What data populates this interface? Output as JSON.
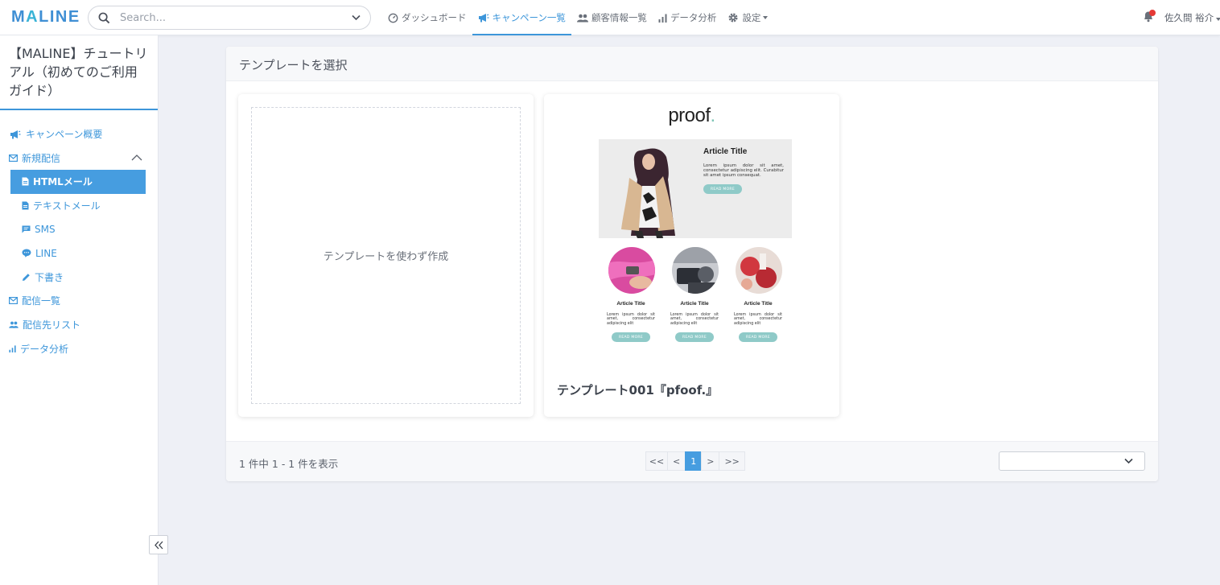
{
  "app": {
    "logo": "MALINE",
    "search_placeholder": "Search...",
    "nav": [
      {
        "label": "ダッシュボード",
        "icon": "speedometer-icon",
        "active": false
      },
      {
        "label": "キャンペーン一覧",
        "icon": "megaphone-icon",
        "active": true
      },
      {
        "label": "顧客情報一覧",
        "icon": "people-icon",
        "active": false
      },
      {
        "label": "データ分析",
        "icon": "bar-chart-icon",
        "active": false
      },
      {
        "label": "設定",
        "icon": "gear-icon",
        "active": false
      }
    ],
    "user_name": "佐久間 裕介",
    "accent_color": "#3d96da",
    "notification_color": "#e53935"
  },
  "sidebar": {
    "campaign_title": "【MALINE】チュートリアル（初めてのご利用ガイド）",
    "menu": [
      {
        "label": "キャンペーン概要",
        "icon": "megaphone-icon"
      },
      {
        "label": "新規配信",
        "icon": "envelope-icon",
        "expanded": true
      },
      {
        "label": "HTMLメール",
        "icon": "document-icon",
        "active": true
      },
      {
        "label": "テキストメール",
        "icon": "document-icon"
      },
      {
        "label": "SMS",
        "icon": "message-icon"
      },
      {
        "label": "LINE",
        "icon": "chat-bubble-icon"
      },
      {
        "label": "下書き",
        "icon": "pencil-icon"
      },
      {
        "label": "配信一覧",
        "icon": "envelope-icon"
      },
      {
        "label": "配信先リスト",
        "icon": "people-icon"
      },
      {
        "label": "データ分析",
        "icon": "bar-chart-icon"
      }
    ],
    "collapse_icon": "double-chevron-left-icon"
  },
  "main": {
    "title": "テンプレートを選択",
    "blank_template_label": "テンプレートを使わず作成",
    "templates": [
      {
        "name": "テンプレート001『pfoof.』",
        "preview": {
          "logo_text": "proof",
          "logo_dot": ".",
          "hero_title": "Article Title",
          "hero_text": "Lorem ipsum dolor sit amet, consectetur adipiscing elit. Curabitur sit amet ipsum consequat.",
          "button_label": "READ MORE",
          "articles": [
            {
              "title": "Article Title",
              "text": "Lorem ipsum dolor sit amet, consectetur adipiscing elit"
            },
            {
              "title": "Article Title",
              "text": "Lorem ipsum dolor sit amet, consectetur adipiscing elit"
            },
            {
              "title": "Article Title",
              "text": "Lorem ipsum dolor sit amet, consectetur adipiscing elit"
            }
          ]
        }
      }
    ],
    "footer": {
      "count_text": "1 件中 1 - 1 件を表示",
      "pagination": [
        "<<",
        "<",
        "1",
        ">",
        ">>"
      ],
      "current_page": "1",
      "per_page_value": ""
    }
  }
}
